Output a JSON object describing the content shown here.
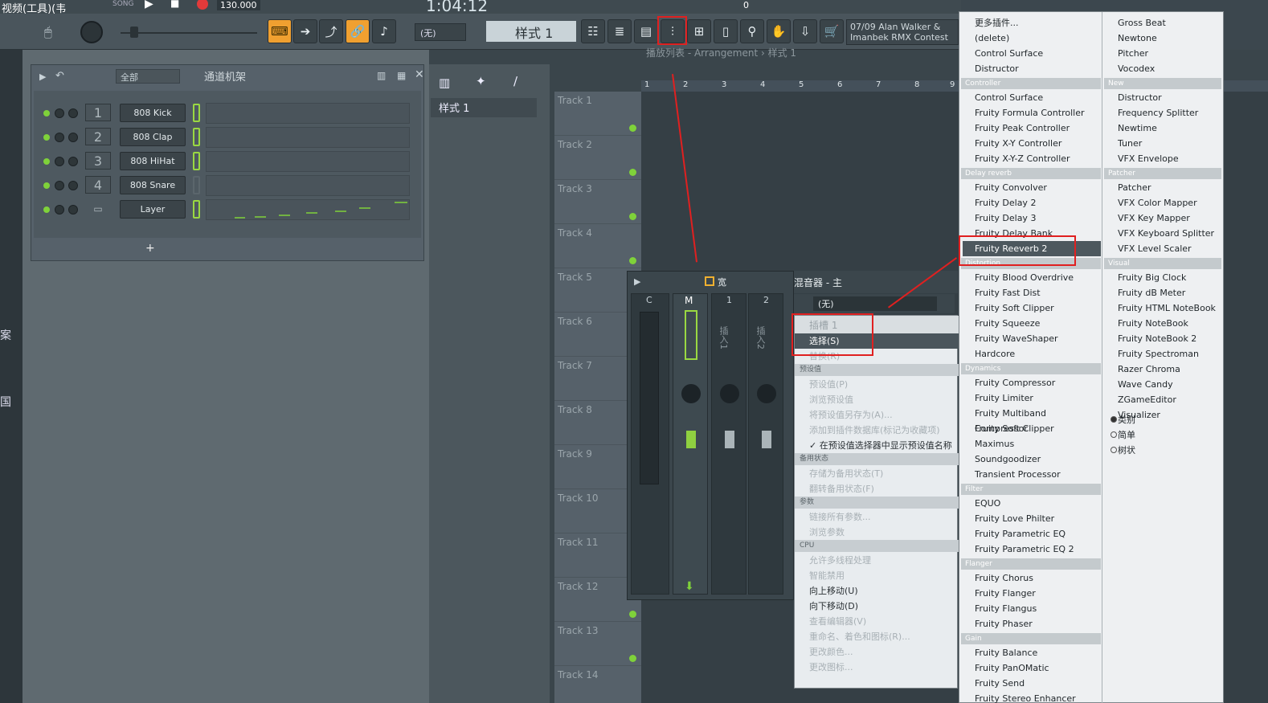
{
  "topbar": {
    "song_label": "SONG",
    "tempo": "130.000",
    "time_display": "1:04:12",
    "pattern_name": "样式 1",
    "pattern_select": "(无)",
    "counter": "0",
    "hint_line1": "07/09  Alan Walker &",
    "hint_line2": "Imanbek RMX Contest",
    "app_title_partial": "视频(工具)(韦"
  },
  "colors": {
    "accent_orange": "#f0a030",
    "led_green": "#7fd23a",
    "annotation_red": "#e02020"
  },
  "channel_rack": {
    "filter": "全部",
    "title": "通道机架",
    "channels": [
      {
        "num": "1",
        "name": "808 Kick"
      },
      {
        "num": "2",
        "name": "808 Clap"
      },
      {
        "num": "3",
        "name": "808 HiHat"
      },
      {
        "num": "4",
        "name": "808 Snare"
      },
      {
        "num": "",
        "name": "Layer"
      }
    ],
    "add_label": "+"
  },
  "playlist": {
    "breadcrumb": "播放列表 - Arrangement › 样式 1",
    "pattern_item": "样式 1",
    "tracks": [
      "Track 1",
      "Track 2",
      "Track 3",
      "Track 4",
      "Track 5",
      "Track 6",
      "Track 7",
      "Track 8",
      "Track 9",
      "Track 10",
      "Track 11",
      "Track 12",
      "Track 13",
      "Track 14"
    ],
    "ruler": [
      "1",
      "2",
      "3",
      "4",
      "5",
      "6",
      "7",
      "8",
      "9"
    ]
  },
  "left_strip": {
    "text1": "案",
    "text2": "国"
  },
  "mixer": {
    "width_label": "宽",
    "title": "混音器 - 主",
    "strips": [
      "C",
      "M",
      "1",
      "2"
    ],
    "insert_labels": [
      "插入1",
      "插入2"
    ],
    "slot_select": "(无)",
    "slot1": "插槽 1"
  },
  "context_menu": {
    "items": [
      {
        "label": "选择(S)",
        "type": "item"
      },
      {
        "label": "替换(R)",
        "type": "dis"
      },
      {
        "label": "预设值",
        "type": "hdr"
      },
      {
        "label": "预设值(P)",
        "type": "dis"
      },
      {
        "label": "浏览预设值",
        "type": "dis"
      },
      {
        "label": "将预设值另存为(A)...",
        "type": "dis"
      },
      {
        "label": "添加到插件数据库(标记为收藏项)",
        "type": "dis"
      },
      {
        "label": "✓ 在预设值选择器中显示预设值名称",
        "type": "item"
      },
      {
        "label": "备用状态",
        "type": "hdr"
      },
      {
        "label": "存储为备用状态(T)",
        "type": "dis"
      },
      {
        "label": "翻转备用状态(F)",
        "type": "dis"
      },
      {
        "label": "参数",
        "type": "hdr"
      },
      {
        "label": "链接所有参数...",
        "type": "dis"
      },
      {
        "label": "浏览参数",
        "type": "dis"
      },
      {
        "label": "CPU",
        "type": "hdr"
      },
      {
        "label": "允许多线程处理",
        "type": "dis"
      },
      {
        "label": "智能禁用",
        "type": "dis"
      },
      {
        "label": "向上移动(U)",
        "type": "item"
      },
      {
        "label": "向下移动(D)",
        "type": "item"
      },
      {
        "label": "查看编辑器(V)",
        "type": "dis"
      },
      {
        "label": "重命名、着色和图标(R)...",
        "type": "dis"
      },
      {
        "label": "更改颜色...",
        "type": "dis"
      },
      {
        "label": "更改图标...",
        "type": "dis"
      }
    ]
  },
  "plugin_menu": {
    "col1": [
      {
        "t": "更多插件...",
        "k": "item"
      },
      {
        "t": "(delete)",
        "k": "item"
      },
      {
        "t": "Control Surface",
        "k": "item"
      },
      {
        "t": "Distructor",
        "k": "item"
      },
      {
        "t": "Controller",
        "k": "hdr"
      },
      {
        "t": "Control Surface",
        "k": "item"
      },
      {
        "t": "Fruity Formula Controller",
        "k": "item"
      },
      {
        "t": "Fruity Peak Controller",
        "k": "item"
      },
      {
        "t": "Fruity X-Y Controller",
        "k": "item"
      },
      {
        "t": "Fruity X-Y-Z Controller",
        "k": "item"
      },
      {
        "t": "Delay reverb",
        "k": "hdr"
      },
      {
        "t": "Fruity Convolver",
        "k": "item"
      },
      {
        "t": "Fruity Delay 2",
        "k": "item"
      },
      {
        "t": "Fruity Delay 3",
        "k": "item"
      },
      {
        "t": "Fruity Delay Bank",
        "k": "item"
      },
      {
        "t": "Fruity Reeverb 2",
        "k": "sel"
      },
      {
        "t": "Distortion",
        "k": "hdr"
      },
      {
        "t": "Fruity Blood Overdrive",
        "k": "item"
      },
      {
        "t": "Fruity Fast Dist",
        "k": "item"
      },
      {
        "t": "Fruity Soft Clipper",
        "k": "item"
      },
      {
        "t": "Fruity Squeeze",
        "k": "item"
      },
      {
        "t": "Fruity WaveShaper",
        "k": "item"
      },
      {
        "t": "Hardcore",
        "k": "item"
      },
      {
        "t": "Dynamics",
        "k": "hdr"
      },
      {
        "t": "Fruity Compressor",
        "k": "item"
      },
      {
        "t": "Fruity Limiter",
        "k": "item"
      },
      {
        "t": "Fruity Multiband Compressor",
        "k": "item"
      },
      {
        "t": "Fruity Soft Clipper",
        "k": "item"
      },
      {
        "t": "Maximus",
        "k": "item"
      },
      {
        "t": "Soundgoodizer",
        "k": "item"
      },
      {
        "t": "Transient Processor",
        "k": "item"
      },
      {
        "t": "Filter",
        "k": "hdr"
      },
      {
        "t": "EQUO",
        "k": "item"
      },
      {
        "t": "Fruity Love Philter",
        "k": "item"
      },
      {
        "t": "Fruity Parametric EQ",
        "k": "item"
      },
      {
        "t": "Fruity Parametric EQ 2",
        "k": "item"
      },
      {
        "t": "Flanger",
        "k": "hdr"
      },
      {
        "t": "Fruity Chorus",
        "k": "item"
      },
      {
        "t": "Fruity Flanger",
        "k": "item"
      },
      {
        "t": "Fruity Flangus",
        "k": "item"
      },
      {
        "t": "Fruity Phaser",
        "k": "item"
      },
      {
        "t": "Gain",
        "k": "hdr"
      },
      {
        "t": "Fruity Balance",
        "k": "item"
      },
      {
        "t": "Fruity PanOMatic",
        "k": "item"
      },
      {
        "t": "Fruity Send",
        "k": "item"
      },
      {
        "t": "Fruity Stereo Enhancer",
        "k": "item"
      }
    ],
    "col2": [
      {
        "t": "Gross Beat",
        "k": "item"
      },
      {
        "t": "Newtone",
        "k": "item"
      },
      {
        "t": "Pitcher",
        "k": "item"
      },
      {
        "t": "Vocodex",
        "k": "item"
      },
      {
        "t": "New",
        "k": "hdr"
      },
      {
        "t": "Distructor",
        "k": "item"
      },
      {
        "t": "Frequency Splitter",
        "k": "item"
      },
      {
        "t": "Newtime",
        "k": "item"
      },
      {
        "t": "Tuner",
        "k": "item"
      },
      {
        "t": "VFX Envelope",
        "k": "item"
      },
      {
        "t": "Patcher",
        "k": "hdr"
      },
      {
        "t": "Patcher",
        "k": "item"
      },
      {
        "t": "VFX Color Mapper",
        "k": "item"
      },
      {
        "t": "VFX Key Mapper",
        "k": "item"
      },
      {
        "t": "VFX Keyboard Splitter",
        "k": "item"
      },
      {
        "t": "VFX Level Scaler",
        "k": "item"
      },
      {
        "t": "Visual",
        "k": "hdr"
      },
      {
        "t": "Fruity Big Clock",
        "k": "item"
      },
      {
        "t": "Fruity dB Meter",
        "k": "item"
      },
      {
        "t": "Fruity HTML NoteBook",
        "k": "item"
      },
      {
        "t": "Fruity NoteBook",
        "k": "item"
      },
      {
        "t": "Fruity NoteBook 2",
        "k": "item"
      },
      {
        "t": "Fruity Spectroman",
        "k": "item"
      },
      {
        "t": "Razer Chroma",
        "k": "item"
      },
      {
        "t": "Wave Candy",
        "k": "item"
      },
      {
        "t": "ZGameEditor Visualizer",
        "k": "item"
      },
      {
        "t": "",
        "k": "sep"
      },
      {
        "t": "类别",
        "k": "radio-on"
      },
      {
        "t": "简单",
        "k": "radio"
      },
      {
        "t": "树状",
        "k": "radio"
      }
    ]
  }
}
